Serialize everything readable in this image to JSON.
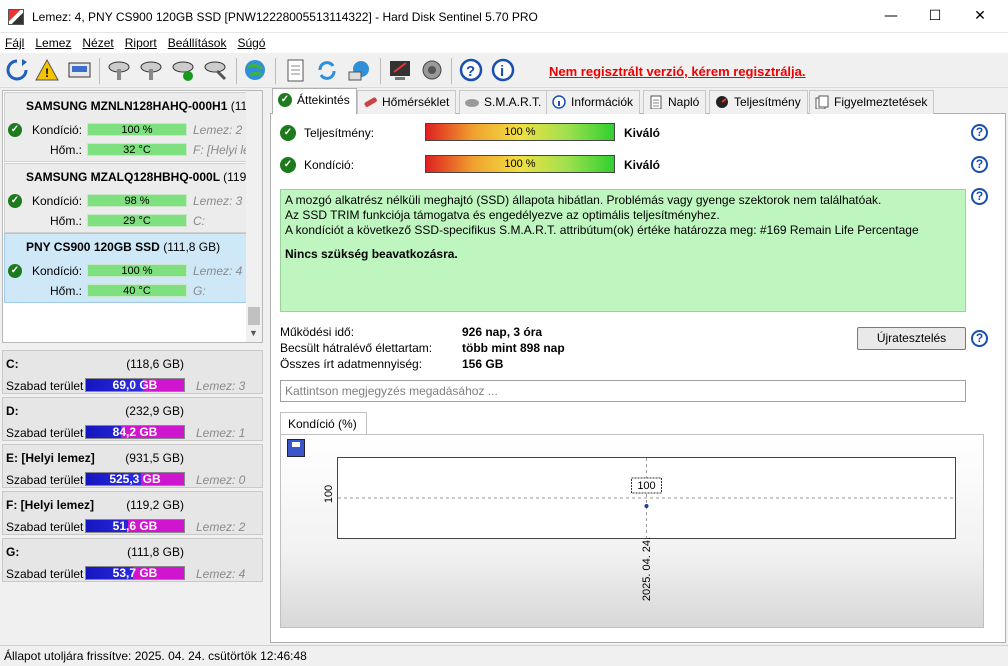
{
  "window": {
    "title": "Lemez: 4, PNY CS900 120GB SSD [PNW12228005513114322]  -  Hard Disk Sentinel 5.70 PRO",
    "minimize": "—",
    "maximize": "☐",
    "close": "✕"
  },
  "menu": [
    "Fájl",
    "Lemez",
    "Nézet",
    "Riport",
    "Beállítások",
    "Súgó"
  ],
  "toolbar": {
    "register_link": "Nem regisztrált verzió, kérem regisztrálja."
  },
  "disks": [
    {
      "name": "SAMSUNG MZNLN128HAHQ-000H1",
      "size": "(11",
      "kondicio_label": "Kondíció:",
      "kondicio": "100 %",
      "kondicio_pct": 100,
      "hom_label": "Hőm.:",
      "hom": "32 °C",
      "disk_idx": "Lemez: 2",
      "drive": "F: [Helyi le"
    },
    {
      "name": "SAMSUNG MZALQ128HBHQ-000L",
      "size": "(119,",
      "kondicio_label": "Kondíció:",
      "kondicio": "98 %",
      "kondicio_pct": 98,
      "hom_label": "Hőm.:",
      "hom": "29 °C",
      "disk_idx": "Lemez: 3",
      "drive": "C:"
    },
    {
      "name": "PNY CS900 120GB SSD",
      "size": "(111,8 GB)",
      "kondicio_label": "Kondíció:",
      "kondicio": "100 %",
      "kondicio_pct": 100,
      "hom_label": "Hőm.:",
      "hom": "40 °C",
      "disk_idx": "Lemez: 4",
      "drive": "G:"
    }
  ],
  "volumes": [
    {
      "letter": "C:",
      "size": "(118,6 GB)",
      "free_label": "Szabad terület",
      "free": "69,0 GB",
      "free_pct": 58,
      "disk": "Lemez: 3"
    },
    {
      "letter": "D:",
      "size": "(232,9 GB)",
      "free_label": "Szabad terület",
      "free": "84,2 GB",
      "free_pct": 36,
      "disk": "Lemez: 1"
    },
    {
      "letter": "E: [Helyi lemez]",
      "size": "(931,5 GB)",
      "free_label": "Szabad terület",
      "free": "525,3 GB",
      "free_pct": 56,
      "disk": "Lemez: 0"
    },
    {
      "letter": "F: [Helyi lemez]",
      "size": "(119,2 GB)",
      "free_label": "Szabad terület",
      "free": "51,6 GB",
      "free_pct": 43,
      "disk": "Lemez: 2"
    },
    {
      "letter": "G:",
      "size": "(111,8 GB)",
      "free_label": "Szabad terület",
      "free": "53,7 GB",
      "free_pct": 48,
      "disk": "Lemez: 4"
    }
  ],
  "tabs": [
    "Áttekintés",
    "Hőmérséklet",
    "S.M.A.R.T.",
    "Információk",
    "Napló",
    "Teljesítmény",
    "Figyelmeztetések"
  ],
  "overview": {
    "perf_label": "Teljesítmény:",
    "perf_value": "100 %",
    "perf_rating": "Kiváló",
    "cond_label": "Kondíció:",
    "cond_value": "100 %",
    "cond_rating": "Kiváló",
    "info_lines": [
      "A mozgó alkatrész nélküli meghajtó (SSD) állapota hibátlan. Problémás vagy gyenge szektorok nem találhatóak.",
      "Az SSD TRIM funkciója támogatva és engedélyezve az optimális teljesítményhez.",
      "A kondíciót a következő SSD-specifikus S.M.A.R.T. attribútum(ok) értéke határozza meg:  #169 Remain Life Percentage"
    ],
    "info_bold": "Nincs szükség beavatkozásra.",
    "uptime_label": "Működési idő:",
    "uptime": "926 nap, 3 óra",
    "lifetime_label": "Becsült hátralévő élettartam:",
    "lifetime": "több mint 898 nap",
    "written_label": "Összes írt adatmennyiség:",
    "written": "156 GB",
    "reset_button": "Újratesztelés",
    "comment_placeholder": "Kattintson megjegyzés megadásához ...",
    "chart_tab": "Kondíció  (%)"
  },
  "chart_data": {
    "type": "line",
    "x": [
      "2025. 04. 24."
    ],
    "series": [
      {
        "values": [
          100
        ]
      }
    ],
    "ytick": "100",
    "point_label": "100"
  },
  "status": "Állapot utoljára frissítve: 2025. 04. 24. csütörtök 12:46:48"
}
